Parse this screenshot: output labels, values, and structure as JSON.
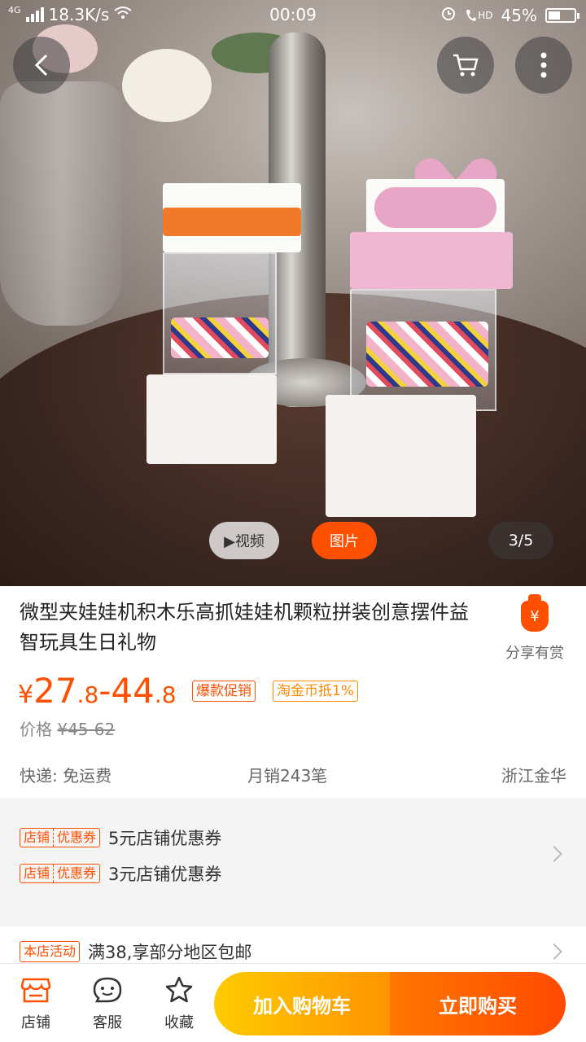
{
  "status_bar": {
    "network": "4G",
    "speed": "18.3K/s",
    "time": "00:09",
    "hd": "HD",
    "battery": "45%",
    "battery_level": 0.45
  },
  "media": {
    "video_label": "▶视频",
    "photo_label": "图片",
    "page_indicator": "3/5"
  },
  "product": {
    "title": "微型夹娃娃机积木乐高抓娃娃机颗粒拼装创意摆件益智玩具生日礼物",
    "share_label": "分享有赏",
    "share_icon_char": "¥",
    "price_symbol": "¥",
    "price_low_int": "27",
    "price_low_dec": ".8",
    "price_sep": "-",
    "price_high_int": "44",
    "price_high_dec": ".8",
    "tag_hot": "爆款促销",
    "tag_coin": "淘金币抵1%",
    "orig_label": "价格",
    "orig_price": "¥45-62",
    "shipping": "快递: 免运费",
    "monthly_sales": "月销243笔",
    "location": "浙江金华"
  },
  "coupons": [
    {
      "tag_a": "店铺",
      "tag_b": "优惠券",
      "text": "5元店铺优惠券"
    },
    {
      "tag_a": "店铺",
      "tag_b": "优惠券",
      "text": "3元店铺优惠券"
    }
  ],
  "activity": {
    "tag": "本店活动",
    "text": "满38,享部分地区包邮"
  },
  "bottom_bar": {
    "shop_label": "店铺",
    "service_label": "客服",
    "favorite_label": "收藏",
    "add_to_cart": "加入购物车",
    "buy_now": "立即购买"
  },
  "colors": {
    "accent": "#ff5000",
    "cart_button": "#ffa000",
    "buy_button": "#ff5a00"
  }
}
